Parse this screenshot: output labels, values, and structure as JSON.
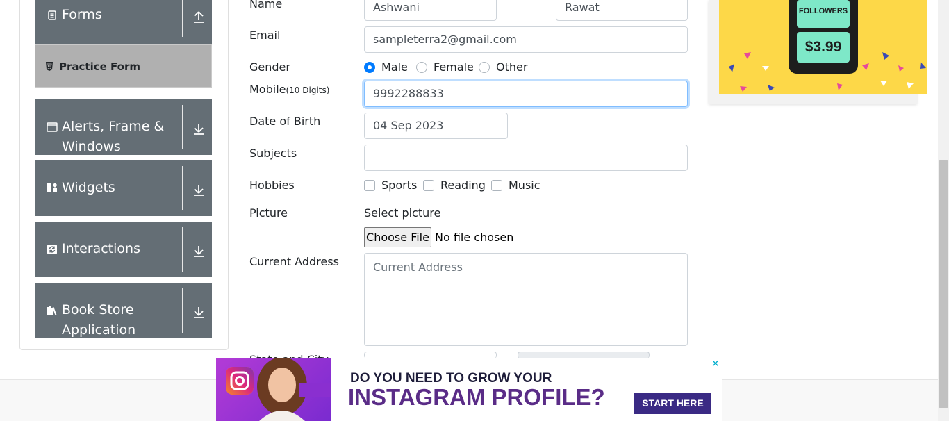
{
  "sidebar": {
    "forms_label": "Forms",
    "practice_form_label": "Practice Form",
    "alerts_label_1": "Alerts, Frame &",
    "alerts_label_2": "Windows",
    "widgets_label": "Widgets",
    "interactions_label": "Interactions",
    "bookstore_label_1": "Book Store",
    "bookstore_label_2": "Application"
  },
  "form": {
    "name_label": "Name",
    "first_name": "Ashwani",
    "last_name": "Rawat",
    "email_label": "Email",
    "email_value": "sampleterra2@gmail.com",
    "gender_label": "Gender",
    "gender_options": [
      "Male",
      "Female",
      "Other"
    ],
    "gender_selected": "Male",
    "mobile_label": "Mobile",
    "mobile_hint": "(10 Digits)",
    "mobile_value": "9992288833",
    "dob_label": "Date of Birth",
    "dob_value": "04 Sep 2023",
    "subjects_label": "Subjects",
    "hobbies_label": "Hobbies",
    "hobbies": [
      "Sports",
      "Reading",
      "Music"
    ],
    "picture_label": "Picture",
    "select_picture": "Select picture",
    "choose_file": "Choose File",
    "no_file": "No file chosen",
    "address_label": "Current Address",
    "address_placeholder": "Current Address",
    "state_city_label": "State and City"
  },
  "ad_right": {
    "followers": "FOLLOWERS",
    "price": "$3.99"
  },
  "ad_bottom": {
    "line1": "DO YOU NEED TO GROW YOUR",
    "line2": "INSTAGRAM PROFILE?",
    "cta": "START HERE",
    "close": "✕"
  },
  "colors": {
    "sidebar_group": "#646e75",
    "active_item": "#b0b0b0",
    "accent": "#007bff"
  }
}
